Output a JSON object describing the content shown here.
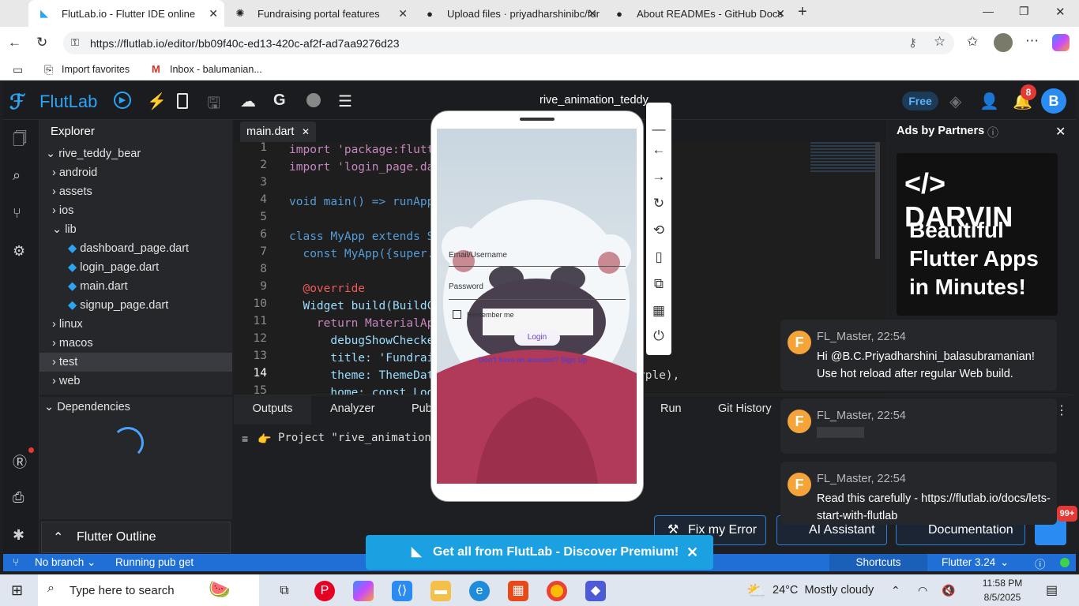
{
  "browser": {
    "tabs": [
      {
        "title": "FlutLab.io - Flutter IDE online",
        "icon": "flutter-icon"
      },
      {
        "title": "Fundraising portal features",
        "icon": "chatgpt-icon"
      },
      {
        "title": "Upload files · priyadharshinibc/fur",
        "icon": "github-icon"
      },
      {
        "title": "About READMEs - GitHub Docs",
        "icon": "github-icon"
      }
    ],
    "new_tab": "+",
    "url": "https://flutlab.io/editor/bb09f40c-ed13-420c-af2f-ad7aa9276d23",
    "favorites": [
      {
        "label": "Import favorites"
      },
      {
        "label": "Inbox - balumanian..."
      }
    ]
  },
  "ide": {
    "brand": "FlutLab",
    "project_title": "rive_animation_teddy",
    "plan_badge": "Free",
    "notifications_count": "8",
    "avatar_letter": "B",
    "explorer_title": "Explorer",
    "tree": [
      {
        "label": "rive_teddy_bear",
        "prefix": "⌄"
      },
      {
        "label": "android",
        "prefix": "›"
      },
      {
        "label": "assets",
        "prefix": "›"
      },
      {
        "label": "ios",
        "prefix": "›"
      },
      {
        "label": "lib",
        "prefix": "⌄"
      },
      {
        "label": "dashboard_page.dart",
        "prefix": ""
      },
      {
        "label": "login_page.dart",
        "prefix": ""
      },
      {
        "label": "main.dart",
        "prefix": ""
      },
      {
        "label": "signup_page.dart",
        "prefix": ""
      },
      {
        "label": "linux",
        "prefix": "›"
      },
      {
        "label": "macos",
        "prefix": "›"
      },
      {
        "label": "test",
        "prefix": "›"
      },
      {
        "label": "web",
        "prefix": "›"
      }
    ],
    "dependencies_title": "Dependencies",
    "outline_title": "Flutter Outline",
    "editor_tab": "main.dart",
    "code_lines": [
      {
        "n": "1",
        "text": "import 'package:flutt"
      },
      {
        "n": "2",
        "text": "import 'login_page.da"
      },
      {
        "n": "3",
        "text": ""
      },
      {
        "n": "4",
        "text": "void main() => runApp"
      },
      {
        "n": "5",
        "text": ""
      },
      {
        "n": "6",
        "text": "class MyApp extends S"
      },
      {
        "n": "7",
        "text": "  const MyApp({super."
      },
      {
        "n": "8",
        "text": ""
      },
      {
        "n": "9",
        "text": "  @override"
      },
      {
        "n": "10",
        "text": "  Widget build(BuildC"
      },
      {
        "n": "11",
        "text": "    return MaterialAp"
      },
      {
        "n": "12",
        "text": "      debugShowChecke"
      },
      {
        "n": "13",
        "text": "      title: 'Fundrai"
      },
      {
        "n": "14",
        "text": "      theme: ThemeDat"
      },
      {
        "n": "15",
        "text": "      home: const Log"
      }
    ],
    "code_tail": "rple),",
    "bottom_tabs": [
      "Outputs",
      "Analyzer",
      "Pub",
      "Run",
      "Git History"
    ],
    "output_line": "Project \"rive_animation_t",
    "ads_title": "Ads by Partners",
    "ad": {
      "brand": "DARVIN",
      "headline": "Beautiful Flutter Apps in Minutes!"
    },
    "fix_error": "Fix my Error",
    "ai_assistant": "AI Assistant",
    "documentation": "Documentation",
    "badge_99": "99+",
    "status": {
      "branch": "No branch",
      "task": "Running pub get",
      "shortcuts": "Shortcuts",
      "flutter": "Flutter 3.24"
    },
    "promo": "Get all from FlutLab - Discover Premium!"
  },
  "phone": {
    "email_label": "Email/Username",
    "password_label": "Password",
    "remember": "Remember me",
    "login": "Login",
    "signup": "Don't have an account? Sign Up"
  },
  "chats": [
    {
      "from": "FL_Master, 22:54",
      "text": "Hi @B.C.Priyadharshini_balasubramanian! Use hot reload after regular Web build."
    },
    {
      "from": "FL_Master, 22:54",
      "text": ""
    },
    {
      "from": "FL_Master, 22:54",
      "text": "Read this carefully - https://flutlab.io/docs/lets-start-with-flutlab"
    }
  ],
  "taskbar": {
    "search_placeholder": "Type here to search",
    "weather": "24°C  Mostly cloudy",
    "time": "11:58 PM",
    "date": "8/5/2025"
  },
  "colors": {
    "accent": "#1f6fd6",
    "flutlab_blue": "#2aa4f4",
    "promo": "#1ba1e2"
  }
}
